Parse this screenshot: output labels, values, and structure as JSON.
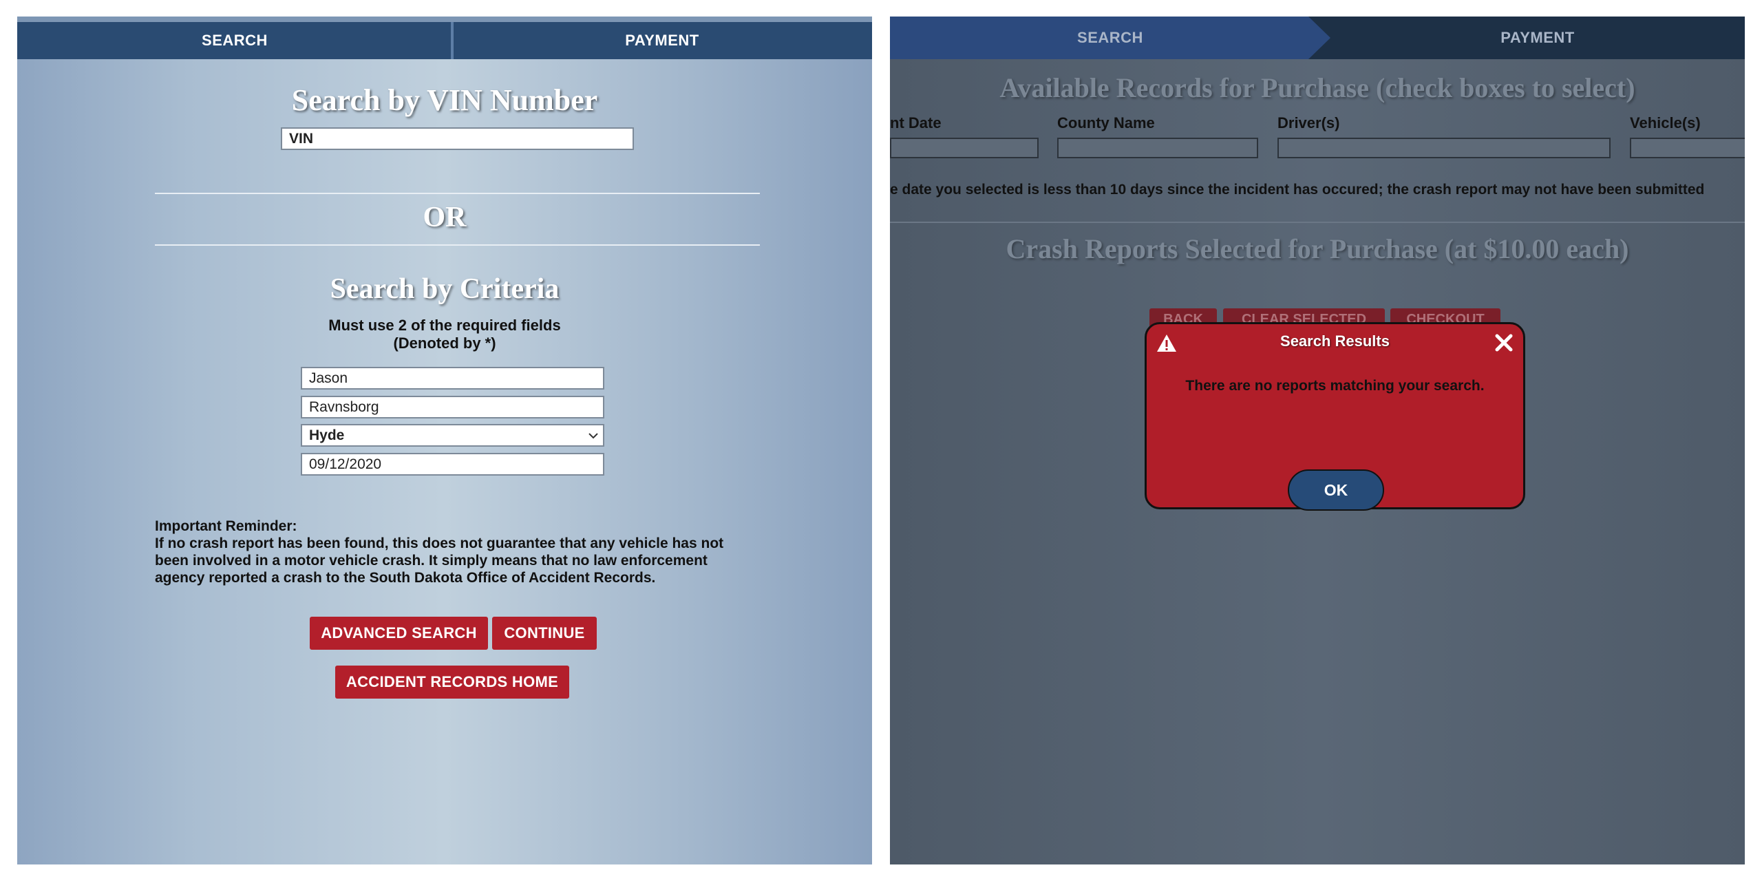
{
  "left": {
    "tabs": {
      "search": "SEARCH",
      "payment": "PAYMENT"
    },
    "vin_heading": "Search by VIN Number",
    "vin_input": "VIN",
    "or_text": "OR",
    "criteria_heading": "Search by Criteria",
    "criteria_note_1": "Must use 2 of the required fields",
    "criteria_note_2": "(Denoted by *)",
    "fields": {
      "first_name": "Jason",
      "last_name": "Ravnsborg",
      "county": "Hyde",
      "date": "09/12/2020"
    },
    "reminder_title": "Important Reminder:",
    "reminder_lines": [
      "If no crash report has been found, this does not guarantee that any vehicle has not",
      "been involved in a motor vehicle crash. It simply means that no law enforcement",
      "agency reported a crash to the South Dakota Office of Accident Records."
    ],
    "buttons": {
      "advanced": "ADVANCED SEARCH",
      "continue": "CONTINUE",
      "home": "ACCIDENT RECORDS HOME"
    }
  },
  "right": {
    "tabs": {
      "search": "SEARCH",
      "payment": "PAYMENT"
    },
    "available_heading": "Available Records for Purchase (check boxes to select)",
    "columns": {
      "date": "nt Date",
      "county": "County Name",
      "drivers": "Driver(s)",
      "vehicles": "Vehicle(s)"
    },
    "notice": "e date you selected is less than 10 days since the incident has occured; the crash report may not have been submitted",
    "selected_heading": "Crash Reports Selected for Purchase (at $10.00 each)",
    "buttons": {
      "back": "BACK",
      "clear": "CLEAR SELECTED",
      "checkout": "CHECKOUT"
    },
    "modal": {
      "title": "Search Results",
      "message": "There are no reports matching your search.",
      "ok": "OK"
    }
  },
  "colors": {
    "tab_navy": "#2a4b72",
    "button_red": "#b31f2b",
    "modal_red": "#b01e29",
    "ok_blue": "#264b78"
  }
}
